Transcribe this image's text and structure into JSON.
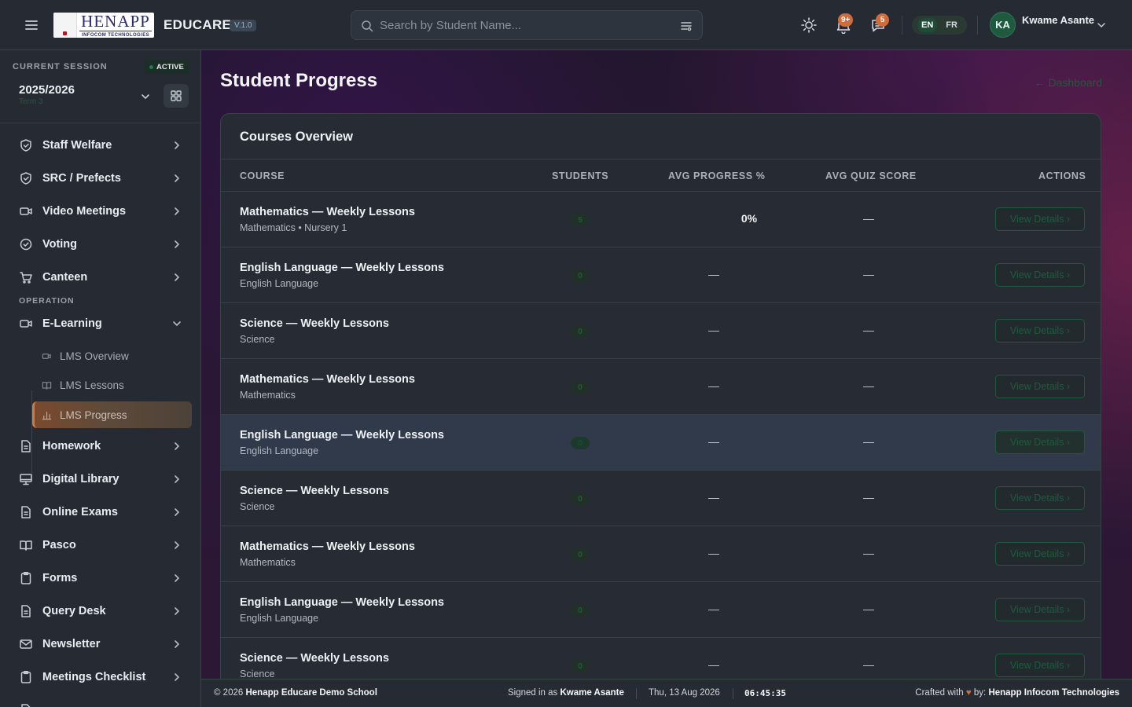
{
  "topbar": {
    "logo_text": "HENAPP",
    "logo_subtext": "INFOCOM TECHNOLOGIES",
    "brand": "EDUCARE",
    "version": "V.1.0",
    "search_placeholder": "Search by Student Name...",
    "notifications_badge": "9+",
    "messages_badge": "5",
    "lang_en": "EN",
    "lang_fr": "FR",
    "user_initials": "KA",
    "user_name": "Kwame Asante"
  },
  "sidebar": {
    "session_label": "CURRENT SESSION",
    "session_status": "ACTIVE",
    "session_year": "2025/2026",
    "session_term": "Term 3",
    "items_top": [
      {
        "label": "Staff Welfare",
        "icon": "shield-icon"
      },
      {
        "label": "SRC / Prefects",
        "icon": "shield-icon"
      },
      {
        "label": "Video Meetings",
        "icon": "video-icon"
      },
      {
        "label": "Voting",
        "icon": "check-circle-icon"
      },
      {
        "label": "Canteen",
        "icon": "cart-icon"
      }
    ],
    "section_operation": "OPERATION",
    "elearning_label": "E-Learning",
    "elearning_sub": [
      {
        "label": "LMS Overview"
      },
      {
        "label": "LMS Lessons"
      },
      {
        "label": "LMS Progress"
      }
    ],
    "items_bottom": [
      {
        "label": "Homework",
        "icon": "document-icon"
      },
      {
        "label": "Digital Library",
        "icon": "monitor-icon"
      },
      {
        "label": "Online Exams",
        "icon": "document-icon"
      },
      {
        "label": "Pasco",
        "icon": "book-icon"
      },
      {
        "label": "Forms",
        "icon": "clipboard-icon"
      },
      {
        "label": "Query Desk",
        "icon": "document-icon"
      },
      {
        "label": "Newsletter",
        "icon": "mail-icon"
      },
      {
        "label": "Meetings Checklist",
        "icon": "clipboard-icon"
      }
    ]
  },
  "main": {
    "page_title": "Student Progress",
    "back_link": "← Dashboard",
    "card_title": "Courses Overview",
    "columns": {
      "course": "COURSE",
      "students": "STUDENTS",
      "avg_progress": "AVG PROGRESS %",
      "avg_quiz": "AVG QUIZ SCORE",
      "actions": "ACTIONS"
    },
    "action_label": "View Details ›",
    "rows": [
      {
        "name": "Mathematics — Weekly Lessons",
        "sub": "Mathematics • Nursery 1",
        "students": "5",
        "progress": "0%",
        "quiz": "—"
      },
      {
        "name": "English Language — Weekly Lessons",
        "sub": "English Language",
        "students": "0",
        "progress": "—",
        "quiz": "—"
      },
      {
        "name": "Science — Weekly Lessons",
        "sub": "Science",
        "students": "0",
        "progress": "—",
        "quiz": "—"
      },
      {
        "name": "Mathematics — Weekly Lessons",
        "sub": "Mathematics",
        "students": "0",
        "progress": "—",
        "quiz": "—"
      },
      {
        "name": "English Language — Weekly Lessons",
        "sub": "English Language",
        "students": "0",
        "progress": "—",
        "quiz": "—"
      },
      {
        "name": "Science — Weekly Lessons",
        "sub": "Science",
        "students": "0",
        "progress": "—",
        "quiz": "—"
      },
      {
        "name": "Mathematics — Weekly Lessons",
        "sub": "Mathematics",
        "students": "0",
        "progress": "—",
        "quiz": "—"
      },
      {
        "name": "English Language — Weekly Lessons",
        "sub": "English Language",
        "students": "0",
        "progress": "—",
        "quiz": "—"
      },
      {
        "name": "Science — Weekly Lessons",
        "sub": "Science",
        "students": "0",
        "progress": "—",
        "quiz": "—"
      }
    ]
  },
  "footer": {
    "copyright_prefix": "© 2026",
    "school": "Henapp Educare Demo School",
    "signed_in_prefix": "Signed in as",
    "signed_in_user": "Kwame Asante",
    "date": "Thu, 13 Aug 2026",
    "time": "06:45:35",
    "crafted_prefix": "Crafted with",
    "crafted_by": "by:",
    "company": "Henapp Infocom Technologies"
  },
  "colors": {
    "accent_green": "#1f5a3e",
    "active_orange": "#d37a43",
    "badge_orange": "#d06b3a"
  }
}
